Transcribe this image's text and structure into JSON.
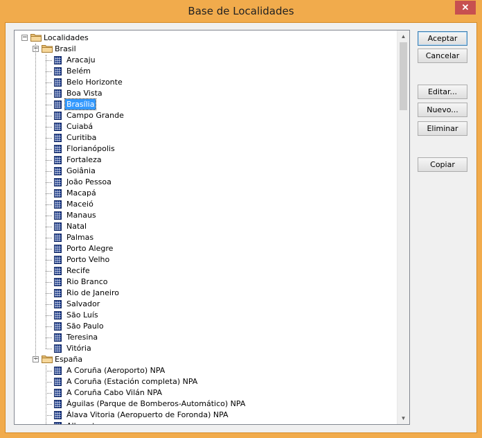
{
  "window": {
    "title": "Base de Localidades",
    "close_symbol": "✕"
  },
  "buttons": {
    "accept": "Aceptar",
    "cancel": "Cancelar",
    "edit": "Editar...",
    "new": "Nuevo...",
    "delete": "Eliminar",
    "copy": "Copiar"
  },
  "tree": {
    "root": "Localidades",
    "brasil": {
      "label": "Brasil",
      "items": [
        "Aracaju",
        "Belém",
        "Belo Horizonte",
        "Boa Vista",
        "Brasília",
        "Campo Grande",
        "Cuiabá",
        "Curitiba",
        "Florianópolis",
        "Fortaleza",
        "Goiânia",
        "João Pessoa",
        "Macapá",
        "Maceió",
        "Manaus",
        "Natal",
        "Palmas",
        "Porto Alegre",
        "Porto Velho",
        "Recife",
        "Rio Branco",
        "Rio de Janeiro",
        "Salvador",
        "São Luís",
        "São Paulo",
        "Teresina",
        "Vitória"
      ],
      "selected": "Brasília"
    },
    "espana": {
      "label": "España",
      "items": [
        "A Coruña (Aeroporto) NPA",
        "A Coruña (Estación completa) NPA",
        "A Coruña Cabo Vilán NPA",
        "Águilas (Parque de Bomberos-Automático) NPA",
        "Álava Vitoria (Aeropuerto de Foronda) NPA",
        "Albacete"
      ]
    }
  },
  "scrollbar": {
    "up_symbol": "▲",
    "down_symbol": "▼"
  }
}
